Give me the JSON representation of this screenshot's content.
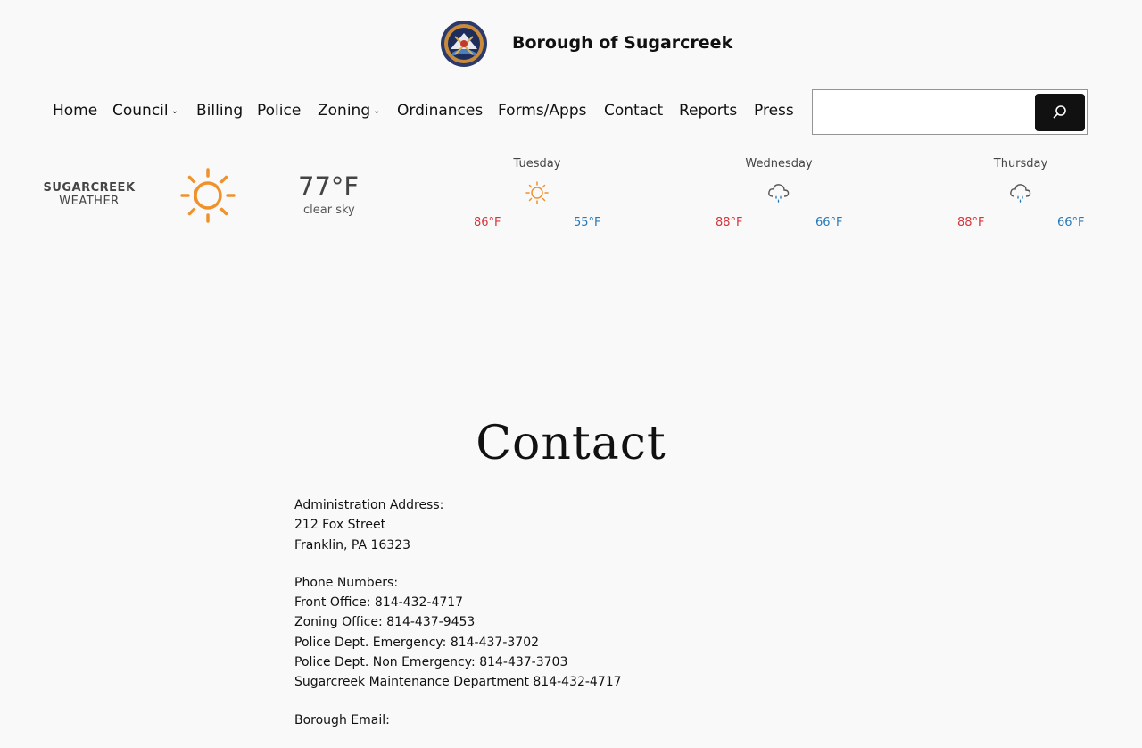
{
  "header": {
    "site_title": "Borough of Sugarcreek",
    "logo_icon": "borough-seal-logo"
  },
  "nav": {
    "items": [
      {
        "label": "Home",
        "has_submenu": false
      },
      {
        "label": "Council",
        "has_submenu": true
      },
      {
        "label": "Billing",
        "has_submenu": false
      },
      {
        "label": "Police",
        "has_submenu": false
      },
      {
        "label": "Zoning",
        "has_submenu": true
      },
      {
        "label": "Ordinances",
        "has_submenu": false
      },
      {
        "label": "Forms/Apps",
        "has_submenu": false
      },
      {
        "label": "Contact",
        "has_submenu": false
      },
      {
        "label": "Reports",
        "has_submenu": false
      },
      {
        "label": "Press",
        "has_submenu": false
      }
    ],
    "chevron": "⌄"
  },
  "search": {
    "value": "",
    "placeholder": "",
    "button_icon": "search-icon"
  },
  "weather": {
    "city": "SUGARCREEK",
    "sub": "WEATHER",
    "current_icon": "sun-icon",
    "current_temp": "77°F",
    "current_desc": "clear sky",
    "forecast": [
      {
        "day": "Tuesday",
        "icon": "sun-icon",
        "high": "86°F",
        "low": "55°F"
      },
      {
        "day": "Wednesday",
        "icon": "rain-cloud-icon",
        "high": "88°F",
        "low": "66°F"
      },
      {
        "day": "Thursday",
        "icon": "rain-cloud-icon",
        "high": "88°F",
        "low": "66°F"
      }
    ],
    "colors": {
      "sun": "#f0922b",
      "high": "#d9343a",
      "low": "#2a7ab8"
    }
  },
  "page": {
    "title": "Contact",
    "address": {
      "heading": "Administration Address:",
      "line1": "212 Fox Street",
      "line2": "Franklin, PA 16323"
    },
    "phones": {
      "heading": "Phone Numbers:",
      "front": "Front Office: 814-432-4717",
      "zoning": "Zoning Office: 814-437-9453",
      "police_emergency": "Police Dept. Emergency: 814-437-3702",
      "police_non": "Police Dept. Non Emergency: 814-437-3703",
      "maintenance": "Sugarcreek Maintenance Department 814-432-4717"
    },
    "email_heading": "Borough Email:"
  }
}
